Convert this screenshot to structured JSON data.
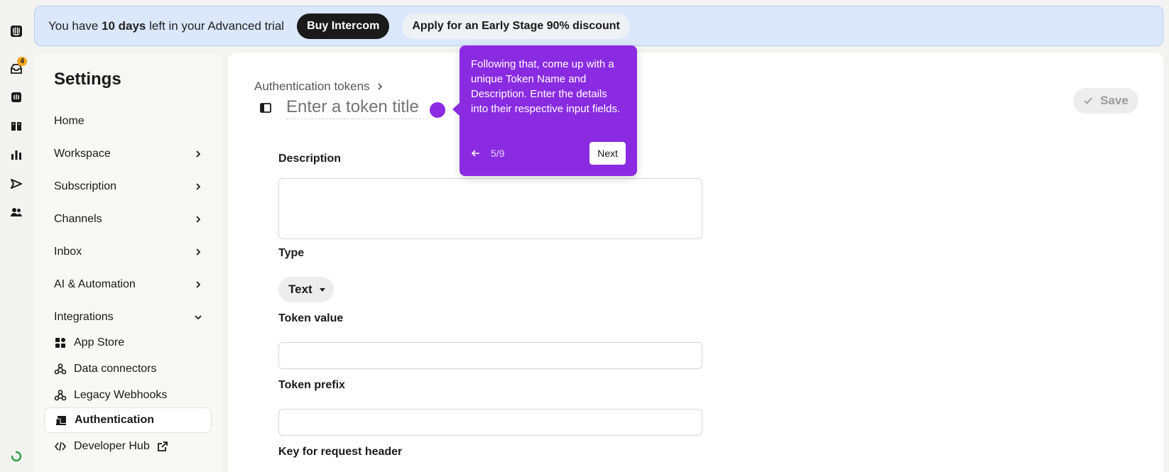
{
  "banner": {
    "prefix": "You have ",
    "days": "10 days",
    "suffix": " left in your Advanced trial",
    "buy_label": "Buy Intercom",
    "discount_label": "Apply for an Early Stage 90% discount"
  },
  "rail": {
    "inbox_badge": "4"
  },
  "sidebar": {
    "title": "Settings",
    "items": [
      {
        "label": "Home"
      },
      {
        "label": "Workspace"
      },
      {
        "label": "Subscription"
      },
      {
        "label": "Channels"
      },
      {
        "label": "Inbox"
      },
      {
        "label": "AI & Automation"
      },
      {
        "label": "Integrations"
      }
    ],
    "sub_items": [
      {
        "label": "App Store",
        "icon": "app-store-icon"
      },
      {
        "label": "Data connectors",
        "icon": "webhook-icon"
      },
      {
        "label": "Legacy Webhooks",
        "icon": "webhook-icon"
      },
      {
        "label": "Authentication",
        "icon": "authentication-icon"
      },
      {
        "label": "Developer Hub",
        "icon": "code-icon"
      }
    ]
  },
  "main": {
    "breadcrumb": "Authentication tokens",
    "title_placeholder": "Enter a token title",
    "save_label": "Save",
    "description_label": "Description",
    "type_label": "Type",
    "type_value": "Text",
    "token_value_label": "Token value",
    "token_prefix_label": "Token prefix",
    "key_header_label": "Key for request header"
  },
  "tooltip": {
    "text": "Following that, come up with a unique Token Name and Description. Enter the details into their respective input fields.",
    "step": "5/9",
    "next_label": "Next"
  },
  "colors": {
    "accent": "#8a2be2",
    "banner_bg": "#dbe7fb",
    "dark_button": "#1a1a1a"
  }
}
